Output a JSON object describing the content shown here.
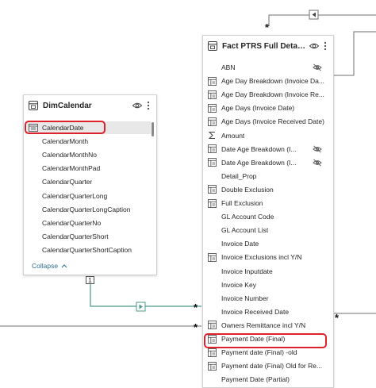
{
  "relationship": {
    "cardinality_one": "1",
    "cardinality_many": "*"
  },
  "dim_table": {
    "title": "DimCalendar",
    "fields": [
      "CalendarDate",
      "CalendarMonth",
      "CalendarMonthNo",
      "CalendarMonthPad",
      "CalendarQuarter",
      "CalendarQuarterLong",
      "CalendarQuarterLongCaption",
      "CalendarQuarterNo",
      "CalendarQuarterShort",
      "CalendarQuarterShortCaption"
    ],
    "collapse_label": "Collapse"
  },
  "fact_table": {
    "title": "Fact PTRS Full Detail I...",
    "fields": [
      {
        "name": "ABN",
        "icon": "none",
        "hidden": true
      },
      {
        "name": "Age Day Breakdown (Invoice Da...",
        "icon": "calc-column-icon",
        "hidden": false
      },
      {
        "name": "Age Day Breakdown (Invoice Re...",
        "icon": "calc-column-icon",
        "hidden": false
      },
      {
        "name": "Age Days (Invoice Date)",
        "icon": "calc-column-icon",
        "hidden": false
      },
      {
        "name": "Age Days (Invoice Received Date)",
        "icon": "calc-column-icon",
        "hidden": false
      },
      {
        "name": "Amount",
        "icon": "sigma-icon",
        "hidden": false
      },
      {
        "name": "Date Age Breakdown (I...",
        "icon": "calc-column-icon",
        "hidden": true
      },
      {
        "name": "Date Age Breakdown (I...",
        "icon": "calc-column-icon",
        "hidden": true
      },
      {
        "name": "Detail_Prop",
        "icon": "none",
        "hidden": false
      },
      {
        "name": "Double Exclusion",
        "icon": "calc-column-icon",
        "hidden": false
      },
      {
        "name": "Full Exclusion",
        "icon": "calc-column-icon",
        "hidden": false
      },
      {
        "name": "GL Account Code",
        "icon": "none",
        "hidden": false
      },
      {
        "name": "GL Account List",
        "icon": "none",
        "hidden": false
      },
      {
        "name": "Invoice Date",
        "icon": "none",
        "hidden": false
      },
      {
        "name": "Invoice Exclusions incl Y/N",
        "icon": "calc-column-icon",
        "hidden": false
      },
      {
        "name": "Invoice Inputdate",
        "icon": "none",
        "hidden": false
      },
      {
        "name": "Invoice Key",
        "icon": "none",
        "hidden": false
      },
      {
        "name": "Invoice Number",
        "icon": "none",
        "hidden": false
      },
      {
        "name": "Invoice Received Date",
        "icon": "none",
        "hidden": false
      },
      {
        "name": "Owners Remittance incl Y/N",
        "icon": "calc-column-icon",
        "hidden": false
      },
      {
        "name": "Payment Date (Final)",
        "icon": "calc-column-icon",
        "hidden": false
      },
      {
        "name": "Payment date (Final) -old",
        "icon": "calc-column-icon",
        "hidden": false
      },
      {
        "name": "Payment date (Final) Old for Re...",
        "icon": "calc-column-icon",
        "hidden": false
      },
      {
        "name": "Payment Date (Partial)",
        "icon": "none",
        "hidden": false
      }
    ]
  },
  "colors": {
    "highlight": "#e0202a",
    "connector_teal": "#4e9a8a",
    "line_gray": "#6f6f6f"
  }
}
